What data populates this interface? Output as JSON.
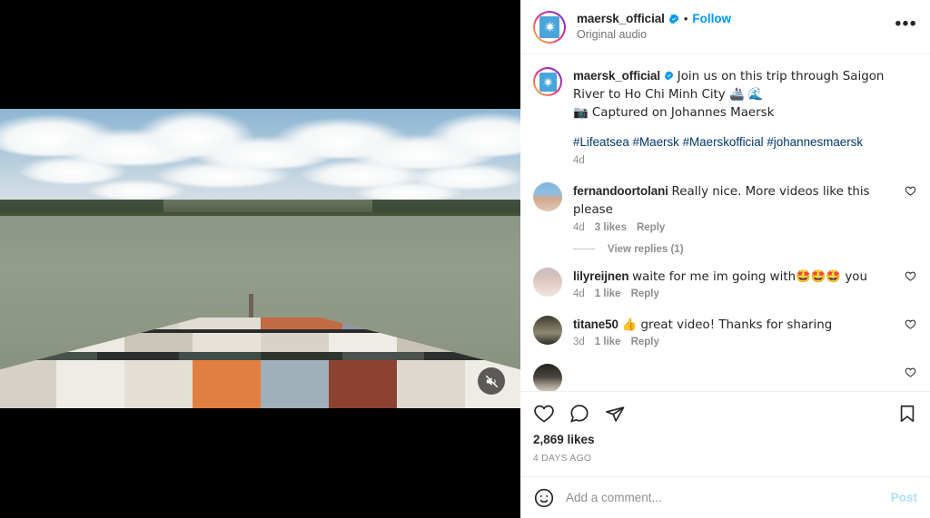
{
  "media": {
    "type": "video",
    "description": "Aerial bow view of a container ship sailing on the Saigon River",
    "mute_icon": "speaker-muted-icon",
    "is_muted": true
  },
  "header": {
    "username": "maersk_official",
    "verified": true,
    "verified_icon": "verified-badge-icon",
    "separator": "•",
    "follow_label": "Follow",
    "audio_label": "Original audio",
    "more_icon": "ellipsis-icon",
    "more_label": "•••",
    "avatar_icon": "maersk-star-logo"
  },
  "caption": {
    "username": "maersk_official",
    "verified": true,
    "text_line1": "Join us on this trip through Saigon River to Ho Chi Minh City 🚢 🌊",
    "text_line2": "📷 Captured on Johannes Maersk",
    "hashtags": "#Lifeatsea #Maersk #Maerskofficial #johannesmaersk",
    "time": "4d"
  },
  "comments": [
    {
      "username": "fernandoortolani",
      "text": "Really nice. More videos like this please",
      "time": "4d",
      "likes": "3 likes",
      "reply_label": "Reply",
      "like_icon": "heart-outline-icon",
      "replies_label": "View replies (1)"
    },
    {
      "username": "lilyreijnen",
      "text": "waite for me im going with🤩🤩🤩 you",
      "time": "4d",
      "likes": "1 like",
      "reply_label": "Reply",
      "like_icon": "heart-outline-icon",
      "replies_label": ""
    },
    {
      "username": "titane50",
      "text": " 👍 great video! Thanks for sharing",
      "time": "3d",
      "likes": "1 like",
      "reply_label": "Reply",
      "like_icon": "heart-outline-icon",
      "replies_label": ""
    },
    {
      "username": "",
      "text": "",
      "time": "",
      "likes": "",
      "reply_label": "",
      "like_icon": "heart-outline-icon",
      "replies_label": ""
    }
  ],
  "actions": {
    "like_icon": "heart-outline-icon",
    "comment_icon": "speech-bubble-icon",
    "share_icon": "paper-plane-icon",
    "save_icon": "bookmark-outline-icon",
    "likes_count": "2,869 likes",
    "post_date": "4 DAYS AGO"
  },
  "add_comment": {
    "emoji_icon": "smiley-face-icon",
    "placeholder": "Add a comment...",
    "value": "",
    "post_label": "Post"
  },
  "colors": {
    "link_blue": "#0095f6",
    "hashtag_blue": "#00376b",
    "post_disabled_blue": "#b2dffc",
    "text_primary": "#262626",
    "text_secondary": "#8e8e8e",
    "border": "#efefef",
    "maersk_blue": "#49a5d9"
  }
}
